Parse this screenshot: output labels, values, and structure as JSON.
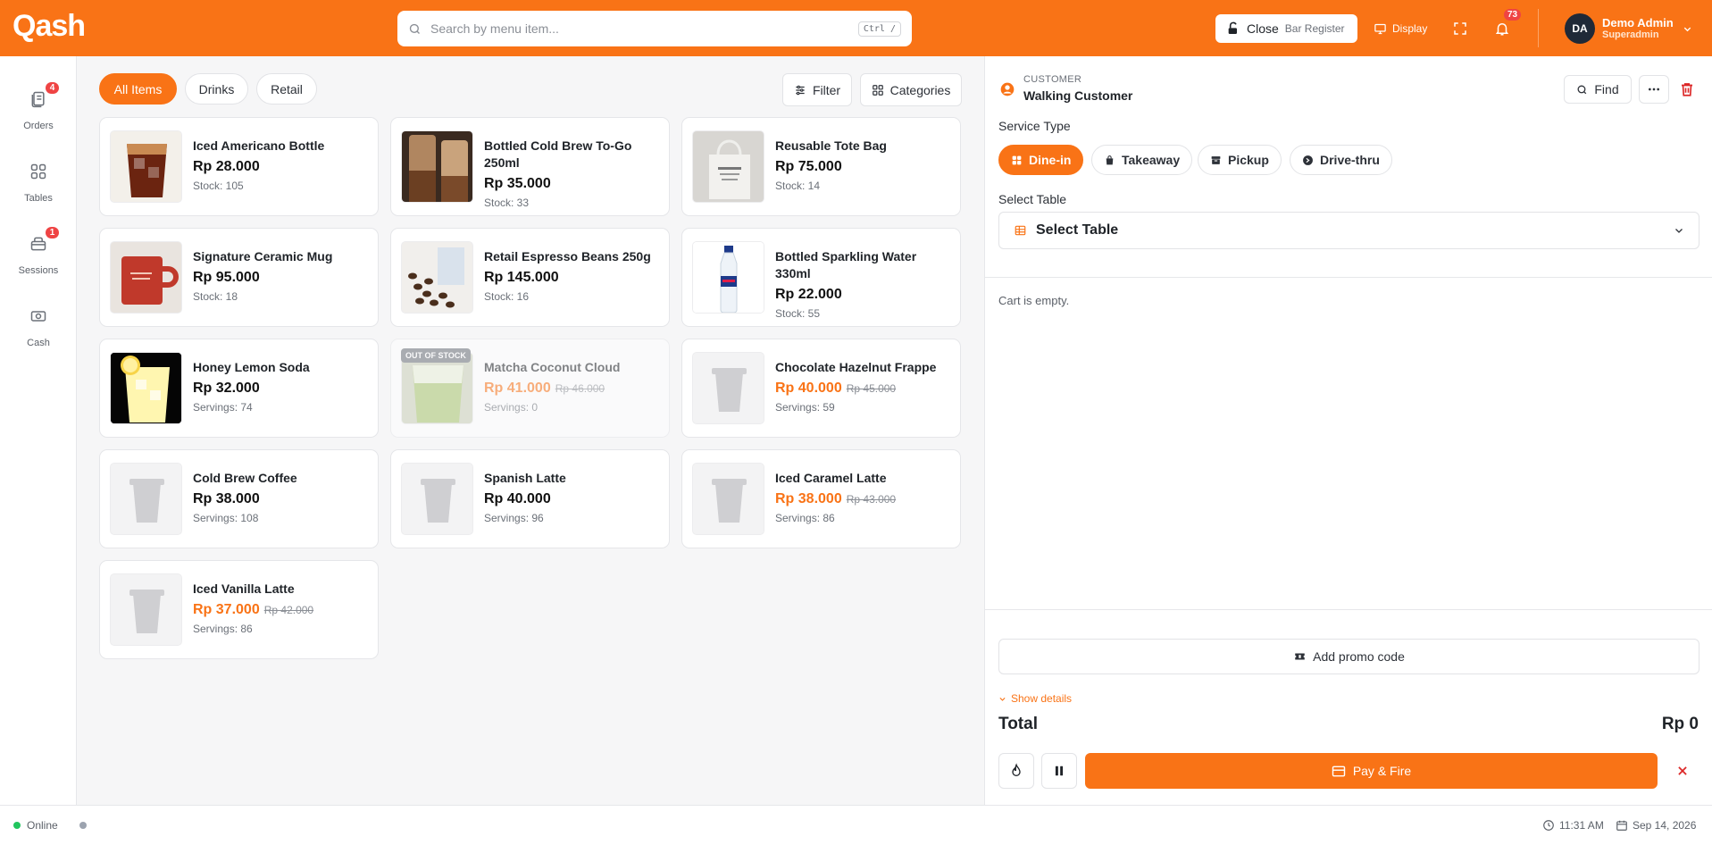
{
  "app": {
    "logo": "Qash"
  },
  "header": {
    "search_placeholder": "Search by menu item...",
    "search_shortcut": "Ctrl /",
    "register_action": "Close",
    "register_name": "Bar Register",
    "display_label": "Display",
    "notification_count": "73",
    "user_initials": "DA",
    "user_name": "Demo Admin",
    "user_role": "Superadmin"
  },
  "sidebar": {
    "items": [
      {
        "label": "Orders",
        "badge": "4"
      },
      {
        "label": "Tables",
        "badge": ""
      },
      {
        "label": "Sessions",
        "badge": "1"
      },
      {
        "label": "Cash",
        "badge": ""
      }
    ]
  },
  "catalog": {
    "filters": [
      "All Items",
      "Drinks",
      "Retail"
    ],
    "filter_button": "Filter",
    "categories_button": "Categories",
    "oos_label": "OUT OF STOCK",
    "products": [
      {
        "name": "Iced Americano Bottle",
        "price": "Rp 28.000",
        "old_price": "",
        "stock": "Stock: 105",
        "image": "americano-photo"
      },
      {
        "name": "Bottled Cold Brew To-Go 250ml",
        "price": "Rp 35.000",
        "old_price": "",
        "stock": "Stock: 33",
        "image": "coldbrew-bottle-photo"
      },
      {
        "name": "Reusable Tote Bag",
        "price": "Rp 75.000",
        "old_price": "",
        "stock": "Stock: 14",
        "image": "tote-bag-photo"
      },
      {
        "name": "Signature Ceramic Mug",
        "price": "Rp 95.000",
        "old_price": "",
        "stock": "Stock: 18",
        "image": "mug-photo"
      },
      {
        "name": "Retail Espresso Beans 250g",
        "price": "Rp 145.000",
        "old_price": "",
        "stock": "Stock: 16",
        "image": "beans-photo"
      },
      {
        "name": "Bottled Sparkling Water 330ml",
        "price": "Rp 22.000",
        "old_price": "",
        "stock": "Stock: 55",
        "image": "water-photo"
      },
      {
        "name": "Honey Lemon Soda",
        "price": "Rp 32.000",
        "old_price": "",
        "stock": "Servings: 74",
        "image": "lemon-soda-photo"
      },
      {
        "name": "Matcha Coconut Cloud",
        "price": "Rp 41.000",
        "old_price": "Rp 46.000",
        "stock": "Servings: 0",
        "image": "matcha-photo"
      },
      {
        "name": "Chocolate Hazelnut Frappe",
        "price": "Rp 40.000",
        "old_price": "Rp 45.000",
        "stock": "Servings: 59",
        "image": "placeholder-cup"
      },
      {
        "name": "Cold Brew Coffee",
        "price": "Rp 38.000",
        "old_price": "",
        "stock": "Servings: 108",
        "image": "placeholder-cup"
      },
      {
        "name": "Spanish Latte",
        "price": "Rp 40.000",
        "old_price": "",
        "stock": "Servings: 96",
        "image": "placeholder-cup"
      },
      {
        "name": "Iced Caramel Latte",
        "price": "Rp 38.000",
        "old_price": "Rp 43.000",
        "stock": "Servings: 86",
        "image": "placeholder-cup"
      },
      {
        "name": "Iced Vanilla Latte",
        "price": "Rp 37.000",
        "old_price": "Rp 42.000",
        "stock": "Servings: 86",
        "image": "placeholder-cup"
      }
    ]
  },
  "order": {
    "customer_label": "CUSTOMER",
    "customer_name": "Walking Customer",
    "find_button": "Find",
    "service_type_label": "Service Type",
    "service_types": [
      "Dine-in",
      "Takeaway",
      "Pickup",
      "Drive-thru"
    ],
    "select_table_label": "Select Table",
    "select_table_value": "Select Table",
    "cart_empty": "Cart is empty.",
    "promo_button": "Add promo code",
    "show_details": "Show details",
    "total_label": "Total",
    "total_value": "Rp 0",
    "pay_button": "Pay & Fire"
  },
  "status": {
    "connection": "Online",
    "time": "11:31 AM",
    "date": "Sep 14, 2026"
  },
  "colors": {
    "accent": "#f97316",
    "danger": "#ef4444",
    "online": "#22c55e"
  }
}
